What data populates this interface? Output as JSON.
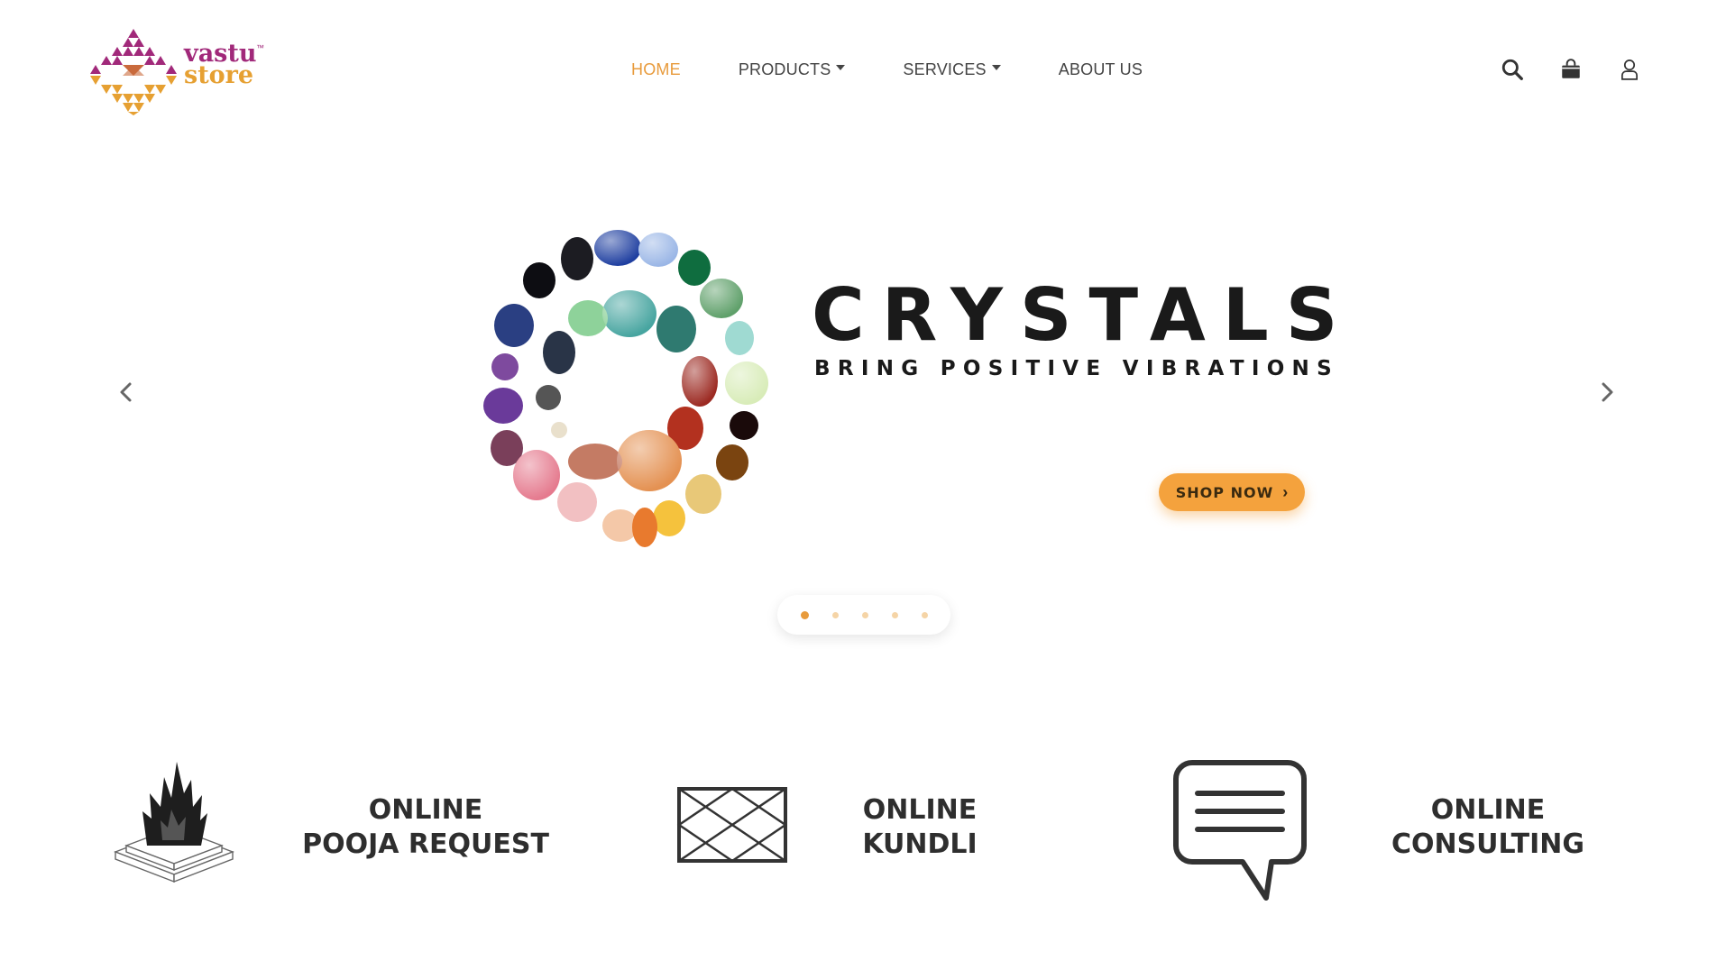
{
  "brand": {
    "name_line1": "vastu",
    "name_line2": "store",
    "trademark": "™",
    "colors": {
      "magenta": "#a1297a",
      "orange": "#e6a032"
    }
  },
  "nav": {
    "items": [
      {
        "label": "HOME",
        "active": true,
        "dropdown": false
      },
      {
        "label": "PRODUCTS",
        "active": false,
        "dropdown": true
      },
      {
        "label": "SERVICES",
        "active": false,
        "dropdown": true
      },
      {
        "label": "ABOUT US",
        "active": false,
        "dropdown": false
      }
    ],
    "active_color": "#e89b3c"
  },
  "header_icons": [
    "search-icon",
    "shopping-bag-icon",
    "user-icon"
  ],
  "hero": {
    "title": "CRYSTALS",
    "subtitle": "BRING POSITIVE VIBRATIONS",
    "cta_label": "SHOP NOW",
    "cta_color": "#f4a23d",
    "slides_count": 5,
    "active_slide": 1
  },
  "services": [
    {
      "line1": "ONLINE",
      "line2": "POOJA REQUEST",
      "icon": "havan-fire-icon"
    },
    {
      "line1": "ONLINE",
      "line2": "KUNDLI",
      "icon": "kundli-chart-icon"
    },
    {
      "line1": "ONLINE",
      "line2": "CONSULTING",
      "icon": "chat-bubble-icon"
    }
  ]
}
